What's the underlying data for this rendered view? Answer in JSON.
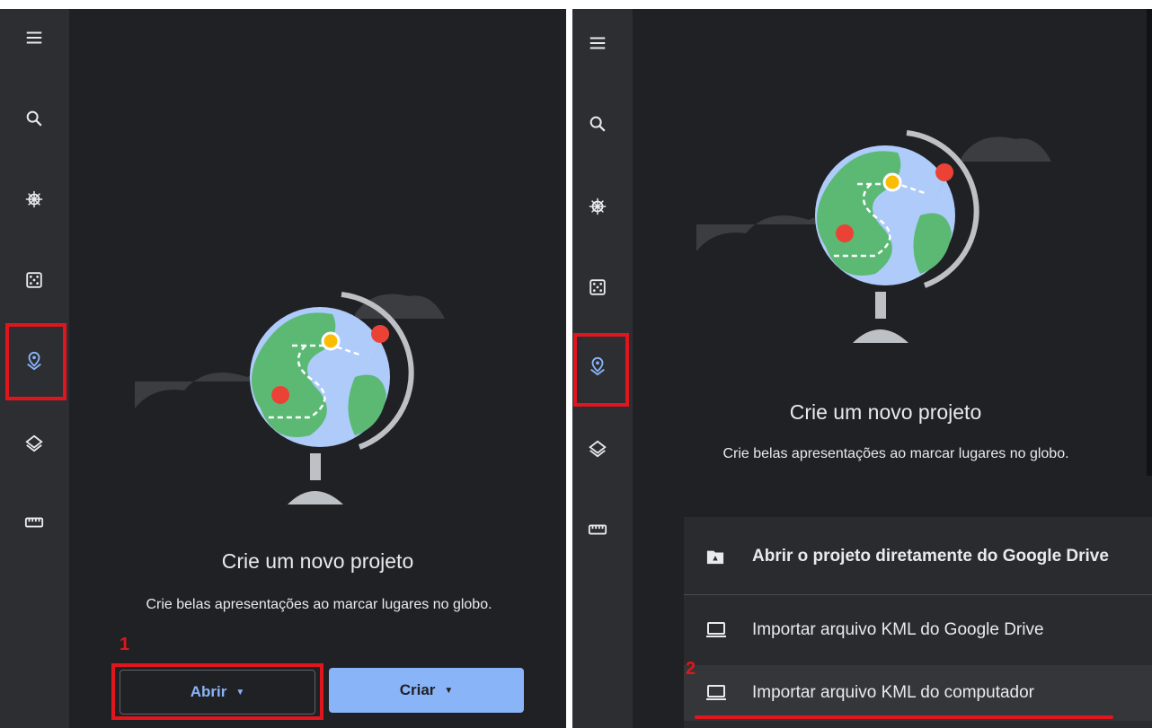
{
  "left": {
    "rail_icons": [
      "menu-icon",
      "search-icon",
      "ship-wheel-icon",
      "dice-icon",
      "projects-pin-icon",
      "layers-icon",
      "ruler-icon"
    ],
    "title": "Crie um novo projeto",
    "description": "Crie belas apresentações ao marcar lugares no globo.",
    "open_button": "Abrir",
    "create_button": "Criar",
    "step_label": "1"
  },
  "right": {
    "title": "Crie um novo projeto",
    "description": "Crie belas apresentações ao marcar lugares no globo.",
    "menu": {
      "header": "Abrir o projeto diretamente do Google Drive",
      "items": [
        "Importar arquivo KML do Google Drive",
        "Importar arquivo KML do computador"
      ]
    },
    "step_label": "2"
  },
  "colors": {
    "background": "#202124",
    "rail": "#2d2e31",
    "accent_blue": "#8ab4f8",
    "highlight_red": "#e0161e"
  }
}
